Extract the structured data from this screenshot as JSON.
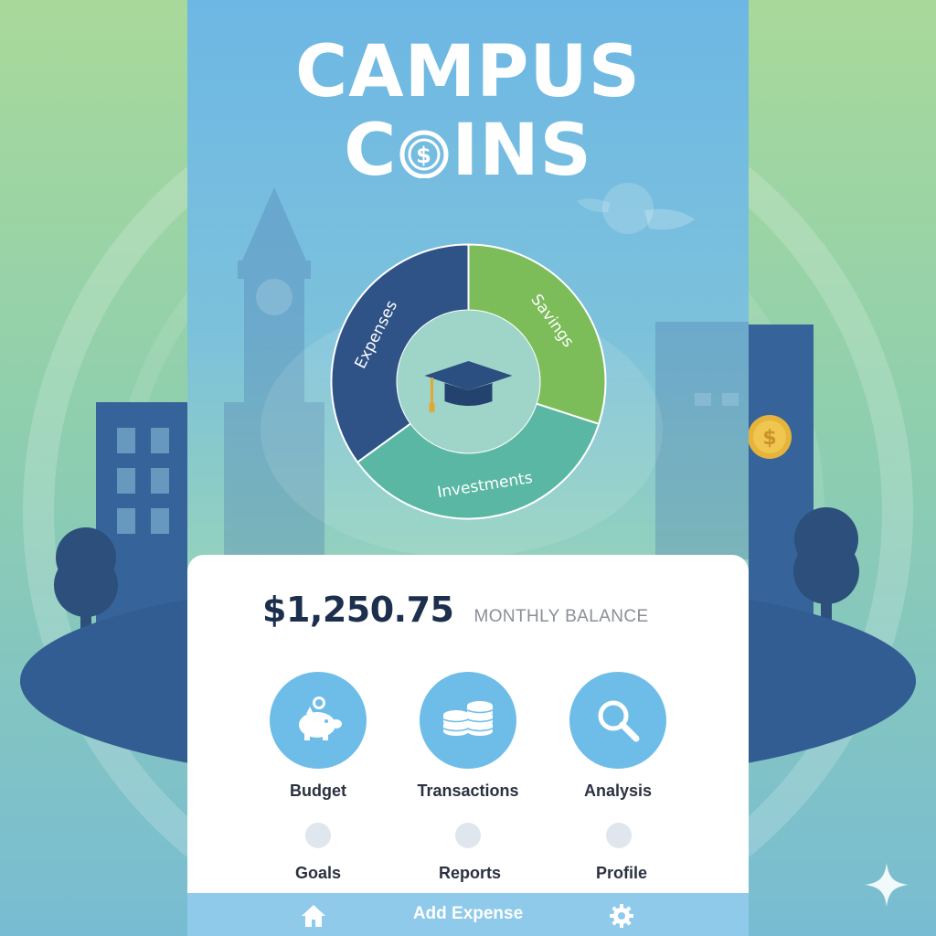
{
  "app": {
    "title_line1": "CAMPUS",
    "title_line2_prefix": "C",
    "title_line2_suffix": "INS"
  },
  "chart_data": {
    "type": "pie",
    "categories": [
      "Expenses",
      "Savings",
      "Investments"
    ],
    "values": [
      35,
      30,
      35
    ],
    "colors": [
      "#2f5287",
      "#7cbd5a",
      "#5ab7a3"
    ],
    "center_icon": "graduation-cap-icon"
  },
  "balance": {
    "amount": "$1,250.75",
    "label": "MONTHLY BALANCE"
  },
  "actions": [
    {
      "label": "Budget",
      "icon": "piggy-bank-icon"
    },
    {
      "label": "Transactions",
      "icon": "coin-stack-icon"
    },
    {
      "label": "Analysis",
      "icon": "magnifier-icon"
    }
  ],
  "secondary": [
    {
      "label": "Goals"
    },
    {
      "label": "Reports"
    },
    {
      "label": "Profile"
    }
  ],
  "bottom_bar": {
    "home_icon": "home-icon",
    "add_label": "Add Expense",
    "settings_icon": "gear-icon"
  },
  "colors": {
    "accent": "#6ebde8",
    "dark_text": "#1c2f4d",
    "bar": "#8fcaea"
  }
}
